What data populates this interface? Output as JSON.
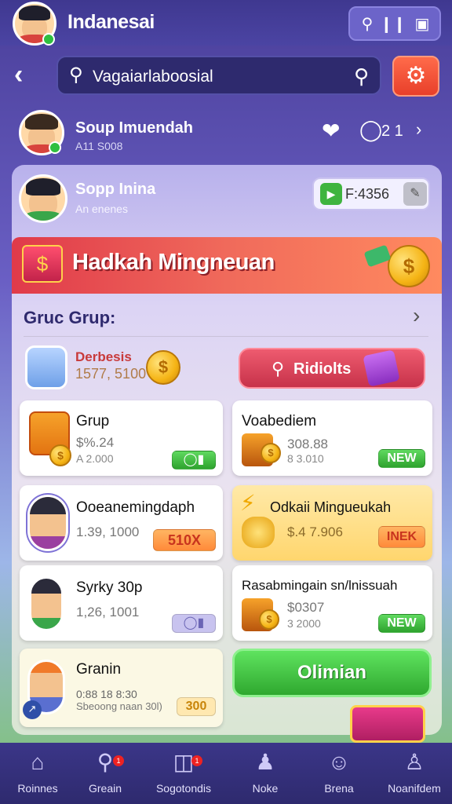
{
  "header": {
    "title": "Indanesai",
    "actions": [
      "chat-icon",
      "bars-icon",
      "inbox-icon"
    ]
  },
  "search": {
    "placeholder": "Vagaiarlaboosial"
  },
  "friends": [
    {
      "name": "Soup Imuendah",
      "sub": "A11 S008",
      "count": "2 1"
    },
    {
      "name": "Sopp Inina",
      "sub": "An enenes",
      "coins": "F:4356"
    }
  ],
  "banner": {
    "title": "Hadkah Mingneuan"
  },
  "section": {
    "title": "Gruc Grup:"
  },
  "deposit": {
    "title": "Derbesis",
    "sub": "1577, 5100",
    "button": "Ridiolts"
  },
  "cards": [
    {
      "title": "Grup",
      "line1": "$%.24",
      "line2": "A 2.000",
      "tag": ""
    },
    {
      "title": "Voabediem",
      "line1": "308.88",
      "line2": "8 3.010",
      "tag": "NEW"
    },
    {
      "title": "Ooeanemingdaph",
      "line1": "1.39, 1000",
      "line2": "",
      "tag": "510X"
    },
    {
      "title": "Odkaii Mingueukah",
      "line1": "$.4 7.906",
      "line2": "",
      "tag": "INEK"
    },
    {
      "title": "Syrky 30p",
      "line1": "1,26, 1001",
      "line2": "",
      "tag": ""
    },
    {
      "title": "Rasabmingain sn/lnissuah",
      "line1": "$0307",
      "line2": "3 2000",
      "tag": "NEW"
    },
    {
      "title": "Granin",
      "line1": "0:88 18 8:30",
      "line2": "Sbeoong naan 30l)",
      "tag": "300"
    }
  ],
  "action_button": {
    "label": "Olimian"
  },
  "nav": [
    {
      "label": "Roinnes",
      "icon": "home-icon"
    },
    {
      "label": "Greain",
      "icon": "search-icon"
    },
    {
      "label": "Sogotondis",
      "icon": "cards-icon"
    },
    {
      "label": "Noke",
      "icon": "user-plus-icon"
    },
    {
      "label": "Brena",
      "icon": "smile-icon"
    },
    {
      "label": "Noanifdem",
      "icon": "profile-icon"
    }
  ]
}
